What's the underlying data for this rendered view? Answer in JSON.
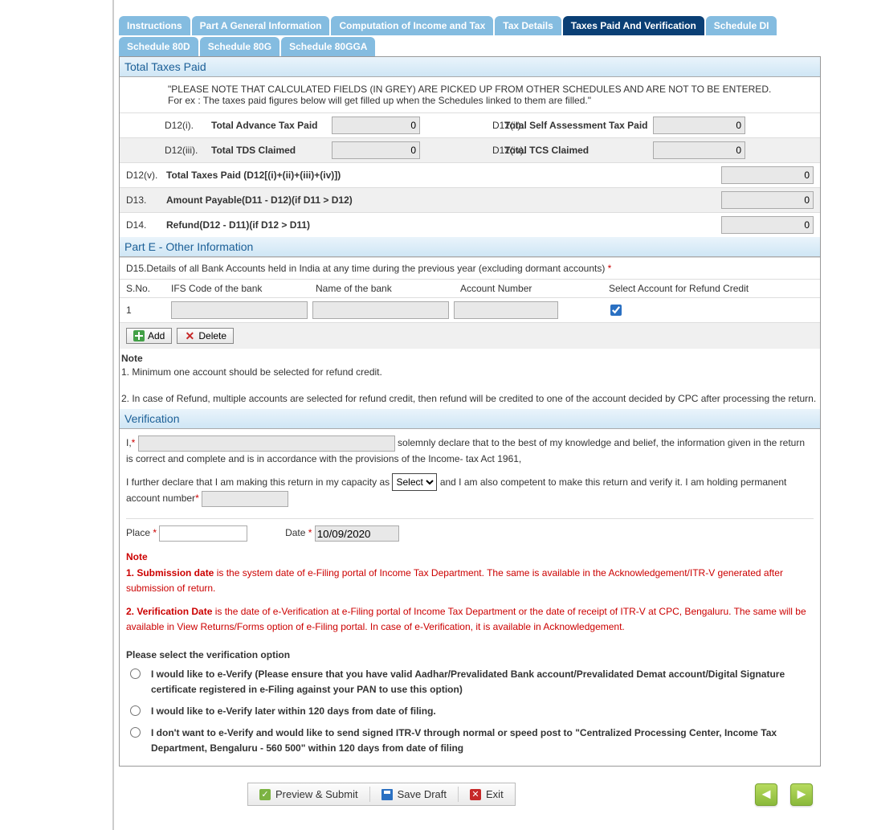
{
  "tabs": {
    "instructions": "Instructions",
    "part_a": "Part A General Information",
    "computation": "Computation of Income and Tax",
    "tax_details": "Tax Details",
    "taxes_paid": "Taxes Paid And Verification",
    "schedule_di": "Schedule DI",
    "schedule_80d": "Schedule 80D",
    "schedule_80g": "Schedule 80G",
    "schedule_80gga": "Schedule 80GGA"
  },
  "sections": {
    "total_taxes_paid": "Total Taxes Paid",
    "part_e": "Part E - Other Information",
    "verification": "Verification"
  },
  "note_fields": "\"PLEASE NOTE THAT CALCULATED FIELDS (IN GREY) ARE PICKED UP FROM OTHER SCHEDULES AND ARE NOT TO BE ENTERED. For ex : The taxes paid figures below will get filled up when the Schedules linked to them are filled.\"",
  "rows": {
    "d12i_code": "D12(i).",
    "d12i_label": "Total Advance Tax Paid",
    "d12i_val": "0",
    "d12ii_code": "D12(ii).",
    "d12ii_label": "Total Self Assessment Tax Paid",
    "d12ii_val": "0",
    "d12iii_code": "D12(iii).",
    "d12iii_label": "Total TDS Claimed",
    "d12iii_val": "0",
    "d12iv_code": "D12(iv).",
    "d12iv_label": "Total TCS Claimed",
    "d12iv_val": "0",
    "d12v_code": "D12(v).",
    "d12v_label": "Total Taxes Paid (D12[(i)+(ii)+(iii)+(iv)])",
    "d12v_val": "0",
    "d13_code": "D13.",
    "d13_label": "Amount Payable(D11 - D12)(if D11 > D12)",
    "d13_val": "0",
    "d14_code": "D14.",
    "d14_label": "Refund(D12 - D11)(if D12 > D11)",
    "d14_val": "0"
  },
  "bank": {
    "d15_pre": "D15.Details of all Bank Accounts held in India at any time during the previous year (excluding dormant accounts) ",
    "h_sno": "S.No.",
    "h_ifs": "IFS Code of the bank",
    "h_name": "Name of the bank",
    "h_acct": "Account Number",
    "h_refund": "Select Account for Refund Credit",
    "row1_sno": "1",
    "add": "Add",
    "delete": "Delete"
  },
  "bank_notes": {
    "title": "Note",
    "n1": "1. Minimum one account should be selected for refund credit.",
    "n2": "2. In case of Refund, multiple accounts are selected for refund credit, then refund will be credited to one of the account decided by CPC after processing the return."
  },
  "verif": {
    "i_prefix": "I,",
    "decl1": " solemnly declare that to the best of my knowledge and belief, the information given in the return is correct and complete and is in accordance with the provisions of the Income- tax Act 1961,",
    "decl2_pre": "I further declare that I am making this return in my capacity as ",
    "select_default": "Select",
    "decl2_post": " and I am also competent to make this return and verify it. I am holding permanent account number",
    "place_label": "Place ",
    "date_label": "Date ",
    "date_val": "10/09/2020",
    "note_title": "Note",
    "note1_b": "1. Submission date",
    "note1_r": " is the system date of e-Filing portal of Income Tax Department. The same is available in the Acknowledgement/ITR-V generated after submission of return.",
    "note2_b": "2. Verification Date",
    "note2_r": " is the date of e-Verification at e-Filing portal of Income Tax Department or the date of receipt of ITR-V at CPC, Bengaluru. The same will be available in View Returns/Forms option of e-Filing portal. In case of e-Verification, it is available in Acknowledgement.",
    "option_title": "Please select the verification option",
    "opt1": "I would like to e-Verify (Please ensure that you have valid Aadhar/Prevalidated Bank account/Prevalidated Demat account/Digital Signature certificate registered in e-Filing against your PAN to use this option)",
    "opt2": "I would like to e-Verify later within 120 days from date of filing.",
    "opt3": "I don't want to e-Verify and would like to send signed ITR-V through normal or speed post to \"Centralized Processing Center, Income Tax Department, Bengaluru - 560 500\" within 120 days from date of filing"
  },
  "footer": {
    "preview": "Preview & Submit",
    "save": "Save Draft",
    "exit": "Exit"
  }
}
